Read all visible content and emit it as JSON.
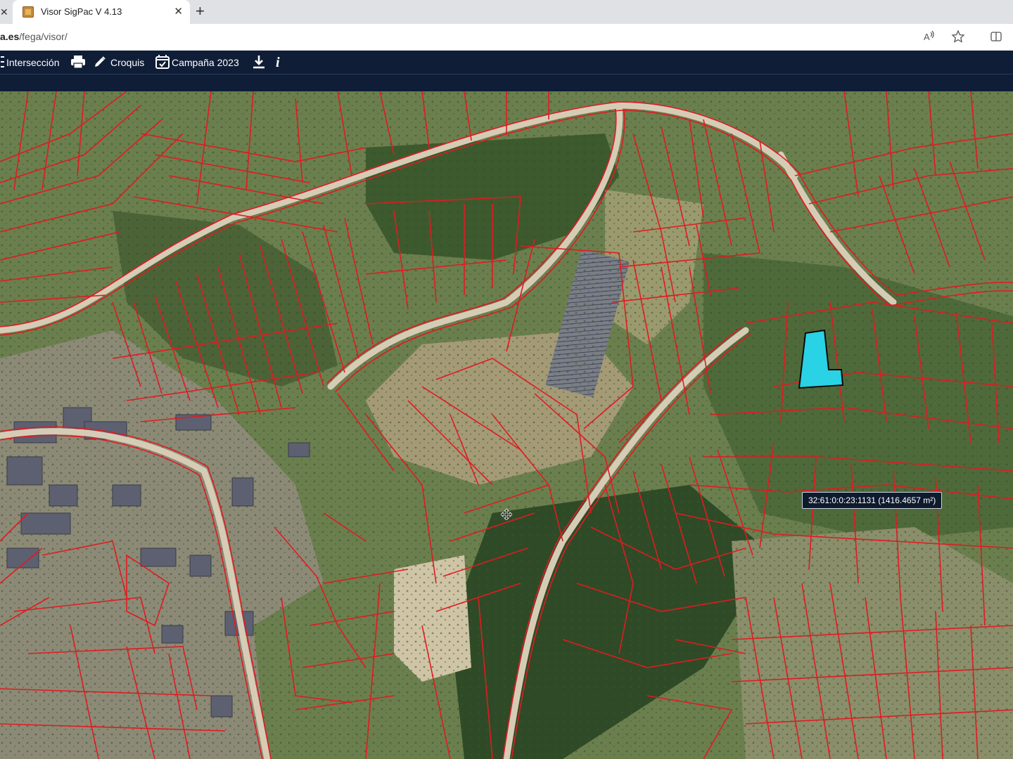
{
  "browser": {
    "tab_title": "Visor SigPac V 4.13",
    "url_host": "a.es",
    "url_path": "/fega/visor/",
    "icons": [
      "close-icon",
      "favicon-icon",
      "new-tab-icon",
      "read-aloud-icon",
      "favorite-star-icon",
      "split-screen-icon"
    ]
  },
  "toolbar": {
    "items": [
      {
        "label": "Intersección",
        "icon": "intersection-icon"
      },
      {
        "label": "",
        "icon": "print-icon"
      },
      {
        "label": "Croquis",
        "icon": "pencil-icon"
      },
      {
        "label": "Campaña 2023",
        "icon": "calendar-icon"
      },
      {
        "label": "",
        "icon": "download-icon"
      },
      {
        "label": "",
        "icon": "info-icon"
      }
    ]
  },
  "map": {
    "parcel_line_color": "#e01b22",
    "selected_fill_color": "#29d2e4",
    "tooltip": "32:61:0:0:23:1131 (1416.4657 m²)"
  }
}
